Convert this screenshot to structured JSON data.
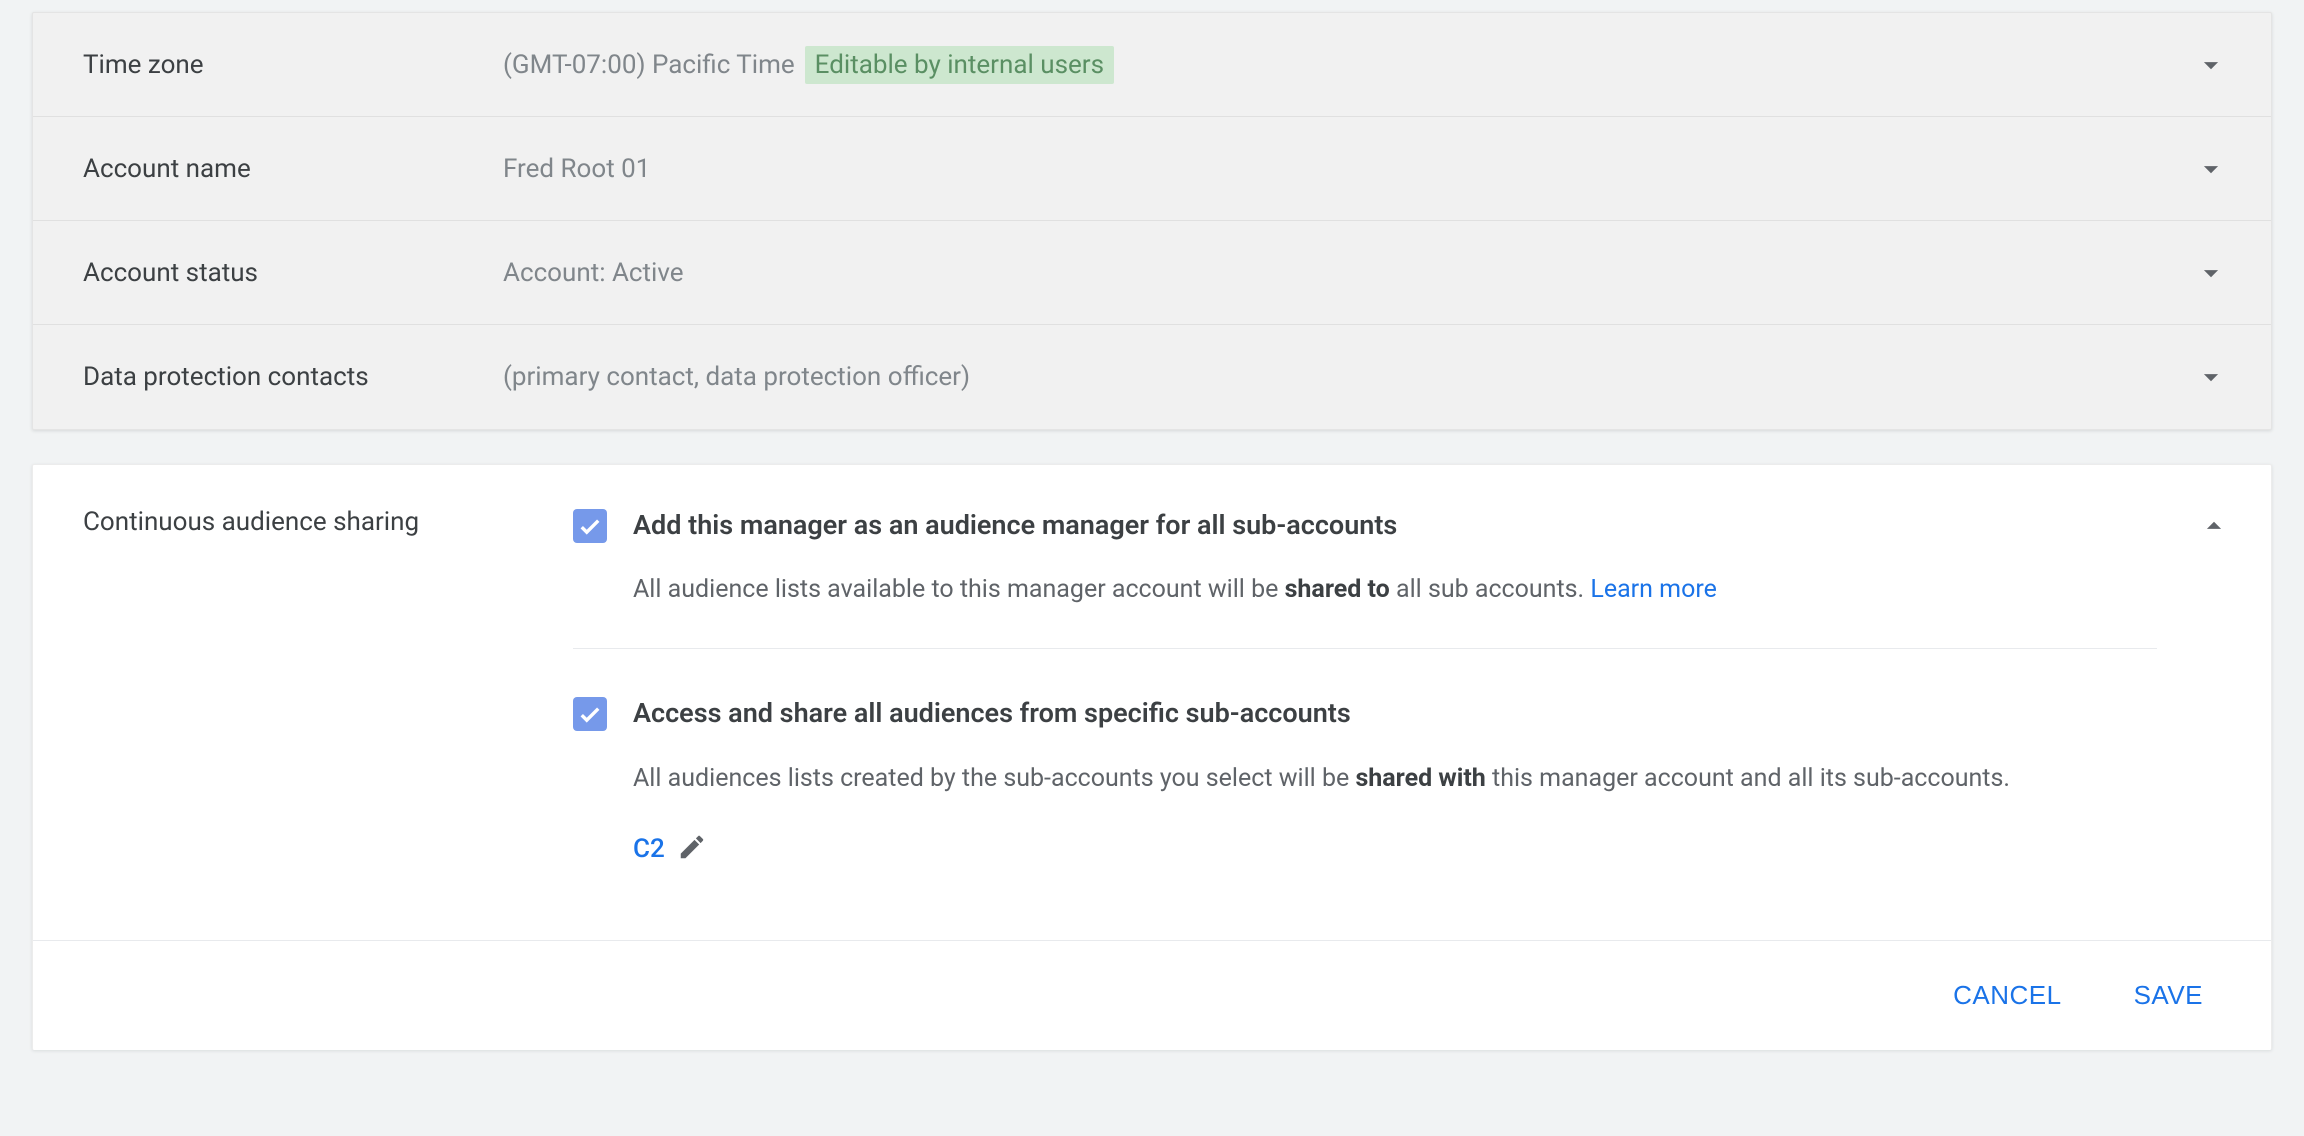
{
  "rows": [
    {
      "label": "Time zone",
      "value": "(GMT-07:00) Pacific Time",
      "badge": "Editable by internal users",
      "badge_visible": true
    },
    {
      "label": "Account name",
      "value": "Fred Root 01",
      "badge_visible": false
    },
    {
      "label": "Account status",
      "value": "Account: Active",
      "badge_visible": false
    },
    {
      "label": "Data protection contacts",
      "value": "(primary contact, data protection officer)",
      "badge_visible": false
    }
  ],
  "sharing": {
    "section_label": "Continuous audience sharing",
    "opt1": {
      "title": "Add this manager as an audience manager for all sub-accounts",
      "desc_pre": "All audience lists available to this manager account will be ",
      "desc_bold": "shared to",
      "desc_post": " all sub accounts. ",
      "learn_more": "Learn more"
    },
    "opt2": {
      "title": "Access and share all audiences from specific sub-accounts",
      "desc_pre": "All audiences lists created by the sub-accounts you select will be ",
      "desc_bold": "shared with",
      "desc_post": " this manager account and all its sub-accounts.",
      "selected": "C2"
    }
  },
  "footer": {
    "cancel": "CANCEL",
    "save": "SAVE"
  }
}
